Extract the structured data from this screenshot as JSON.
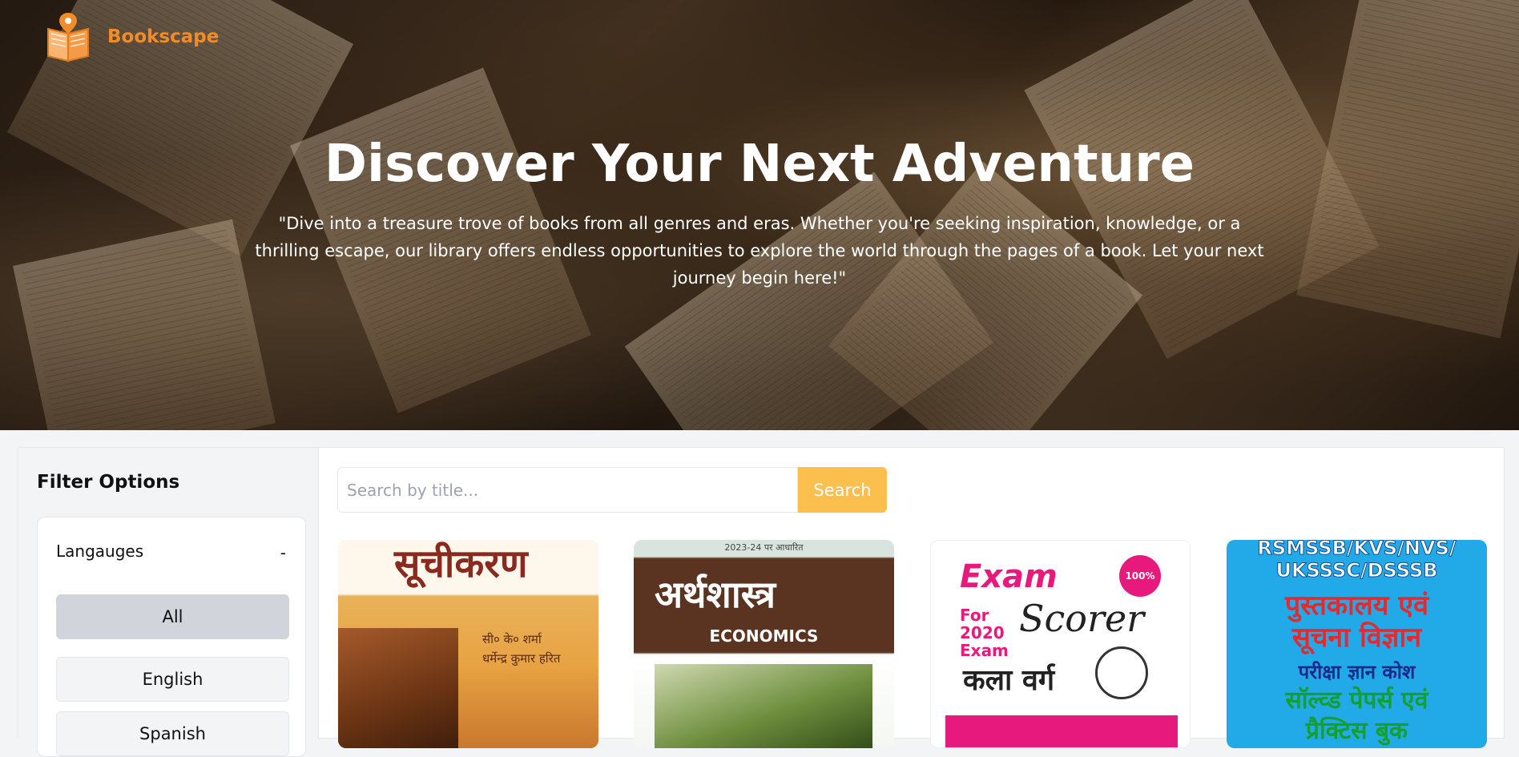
{
  "brand": {
    "name": "Bookscape",
    "logo_icon": "open-book-location-pin-icon",
    "accent": "#f28c28"
  },
  "hero": {
    "title": "Discover Your Next Adventure",
    "subtitle": "\"Dive into a treasure trove of books from all genres and eras. Whether you're seeking inspiration, knowledge, or a thrilling escape, our library offers endless opportunities to explore the world through the pages of a book. Let your next journey begin here!\""
  },
  "filters": {
    "title": "Filter Options",
    "section_label": "Langauges",
    "toggle_symbol": "-",
    "options": [
      "All",
      "English",
      "Spanish"
    ],
    "selected": "All"
  },
  "search": {
    "placeholder": "Search by title...",
    "value": "",
    "button_label": "Search",
    "button_color": "#fbbf4d"
  },
  "books": [
    {
      "cover_title": "सूचीकरण",
      "cover_author": "सी० के० शर्मा\nधर्मेन्द्र कुमार हरित"
    },
    {
      "cover_top": "2023-24 पर आधारित",
      "cover_title": "अर्थशास्त्र",
      "cover_subtitle": "ECONOMICS"
    },
    {
      "cover_badge": "100%",
      "cover_title": "Exam",
      "cover_subtitle": "Scorer",
      "cover_for": "For\n2020\nExam",
      "cover_stream": "कला वर्ग"
    },
    {
      "cover_line1": "RSMSSB/KVS/NVS/\nUKSSSC/DSSSB",
      "cover_line2": "पुस्तकालय एवं\nसूचना विज्ञान",
      "cover_line3": "परीक्षा ज्ञान कोश",
      "cover_line4": "सॉल्व्ड पेपर्स एवं\nप्रैक्टिस बुक"
    }
  ]
}
